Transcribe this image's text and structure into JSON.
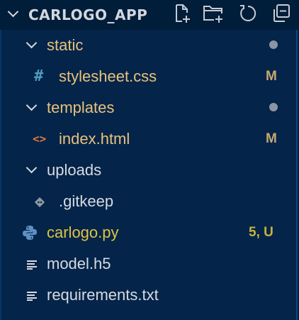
{
  "explorer": {
    "title": "CARLOGO_APP",
    "actions": [
      {
        "name": "new-file-icon"
      },
      {
        "name": "new-folder-icon"
      },
      {
        "name": "refresh-icon"
      },
      {
        "name": "collapse-all-icon"
      }
    ]
  },
  "tree": {
    "static": {
      "label": "static",
      "icon": "chevron-down-icon",
      "status": "modified-dot"
    },
    "stylesheet": {
      "label": "stylesheet.css",
      "icon": "css-file-icon",
      "icon_glyph": "#",
      "status": "M"
    },
    "templates": {
      "label": "templates",
      "icon": "chevron-down-icon",
      "status": "modified-dot"
    },
    "index": {
      "label": "index.html",
      "icon": "html-file-icon",
      "icon_glyph": "<>",
      "status": "M"
    },
    "uploads": {
      "label": "uploads",
      "icon": "chevron-down-icon"
    },
    "gitkeep": {
      "label": ".gitkeep",
      "icon": "git-icon"
    },
    "carlogo": {
      "label": "carlogo.py",
      "icon": "python-icon",
      "status": "5, U"
    },
    "model": {
      "label": "model.h5",
      "icon": "text-file-icon"
    },
    "requirements": {
      "label": "requirements.txt",
      "icon": "text-file-icon"
    }
  },
  "colors": {
    "background": "#001d3a",
    "panel": "#04244a",
    "border": "#0a4a83",
    "text": "#d7dbe0",
    "modified_text": "#e8c27a",
    "untracked_text": "#dcc443",
    "status_modified": "#c9a872",
    "status_untracked": "#c4b23a",
    "css_icon": "#519aba",
    "html_icon": "#e37933",
    "python_icon": "#5d91c2"
  }
}
